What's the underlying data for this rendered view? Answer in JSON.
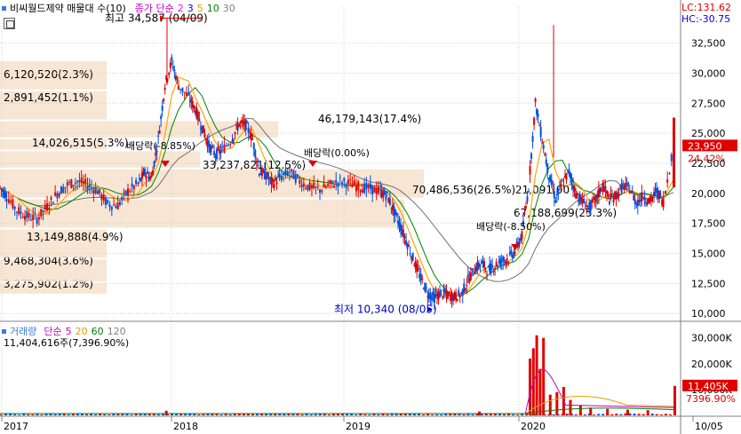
{
  "header": {
    "title": "비씨월드제약 매물대 수(10)",
    "price_label": "종가 단순",
    "ma_periods": [
      "2",
      "3",
      "5",
      "10",
      "30"
    ],
    "ma_colors": [
      "#ff00ff",
      "#0000ff",
      "#ffa500",
      "#008000",
      "#808080"
    ],
    "lc": "LC:131.62",
    "hc": "HC:-30.75"
  },
  "volume_header": {
    "label": "거래량",
    "ma_label": "단순",
    "ma_periods": [
      "5",
      "20",
      "60",
      "120"
    ],
    "ma_colors": [
      "#c000c0",
      "#e0a000",
      "#008000",
      "#808080"
    ],
    "info": "11,404,616주(7,396.90%)"
  },
  "annotations": {
    "high": "최고 34,587 (04/09)",
    "low": "최저 10,340 (08/05)",
    "dividend_1": "배당락(-8.85%)",
    "dividend_2": "배당락(0.00%)",
    "dividend_3": "배당락(-8.50%)"
  },
  "current": {
    "price": "23,950",
    "change": "24.42%",
    "volume": "11,405K",
    "volume_pct": "7396.90%"
  },
  "chart_data": [
    {
      "type": "candlestick",
      "title": "비씨월드제약 매물대 수(10)",
      "x_ticks": [
        "2017",
        "2018",
        "2019",
        "2020",
        "10/05"
      ],
      "y_ticks": [
        "10,000",
        "12,500",
        "15,000",
        "17,500",
        "20,000",
        "22,500",
        "25,000",
        "27,500",
        "30,000",
        "32,500"
      ],
      "ylim": [
        9500,
        35500
      ],
      "high": {
        "value": 34587,
        "date": "04/09"
      },
      "low": {
        "value": 10340,
        "date": "08/05"
      },
      "close_series": [
        {
          "t": 0.0,
          "v": 20500
        },
        {
          "t": 0.01,
          "v": 19800
        },
        {
          "t": 0.025,
          "v": 18600
        },
        {
          "t": 0.04,
          "v": 18100
        },
        {
          "t": 0.055,
          "v": 17900
        },
        {
          "t": 0.07,
          "v": 18900
        },
        {
          "t": 0.085,
          "v": 20000
        },
        {
          "t": 0.1,
          "v": 20700
        },
        {
          "t": 0.115,
          "v": 21000
        },
        {
          "t": 0.13,
          "v": 20700
        },
        {
          "t": 0.145,
          "v": 20200
        },
        {
          "t": 0.16,
          "v": 19100
        },
        {
          "t": 0.175,
          "v": 19000
        },
        {
          "t": 0.19,
          "v": 20200
        },
        {
          "t": 0.205,
          "v": 20800
        },
        {
          "t": 0.215,
          "v": 21700
        },
        {
          "t": 0.225,
          "v": 21300
        },
        {
          "t": 0.235,
          "v": 24500
        },
        {
          "t": 0.245,
          "v": 29000
        },
        {
          "t": 0.255,
          "v": 31000
        },
        {
          "t": 0.265,
          "v": 29000
        },
        {
          "t": 0.28,
          "v": 28000
        },
        {
          "t": 0.29,
          "v": 27000
        },
        {
          "t": 0.3,
          "v": 25500
        },
        {
          "t": 0.31,
          "v": 24000
        },
        {
          "t": 0.32,
          "v": 23200
        },
        {
          "t": 0.33,
          "v": 23600
        },
        {
          "t": 0.345,
          "v": 24600
        },
        {
          "t": 0.355,
          "v": 25800
        },
        {
          "t": 0.365,
          "v": 25700
        },
        {
          "t": 0.375,
          "v": 24500
        },
        {
          "t": 0.385,
          "v": 21800
        },
        {
          "t": 0.395,
          "v": 21500
        },
        {
          "t": 0.405,
          "v": 20800
        },
        {
          "t": 0.415,
          "v": 21300
        },
        {
          "t": 0.43,
          "v": 21800
        },
        {
          "t": 0.445,
          "v": 21000
        },
        {
          "t": 0.46,
          "v": 20500
        },
        {
          "t": 0.475,
          "v": 20300
        },
        {
          "t": 0.49,
          "v": 20700
        },
        {
          "t": 0.505,
          "v": 21000
        },
        {
          "t": 0.52,
          "v": 20800
        },
        {
          "t": 0.535,
          "v": 20500
        },
        {
          "t": 0.55,
          "v": 20400
        },
        {
          "t": 0.565,
          "v": 20100
        },
        {
          "t": 0.575,
          "v": 19800
        },
        {
          "t": 0.585,
          "v": 18500
        },
        {
          "t": 0.595,
          "v": 17200
        },
        {
          "t": 0.605,
          "v": 15800
        },
        {
          "t": 0.615,
          "v": 14300
        },
        {
          "t": 0.625,
          "v": 12900
        },
        {
          "t": 0.635,
          "v": 11700
        },
        {
          "t": 0.645,
          "v": 11300
        },
        {
          "t": 0.655,
          "v": 11700
        },
        {
          "t": 0.665,
          "v": 11500
        },
        {
          "t": 0.675,
          "v": 11400
        },
        {
          "t": 0.685,
          "v": 11600
        },
        {
          "t": 0.695,
          "v": 12800
        },
        {
          "t": 0.705,
          "v": 13700
        },
        {
          "t": 0.715,
          "v": 14200
        },
        {
          "t": 0.725,
          "v": 13600
        },
        {
          "t": 0.735,
          "v": 14000
        },
        {
          "t": 0.745,
          "v": 14400
        },
        {
          "t": 0.755,
          "v": 14600
        },
        {
          "t": 0.765,
          "v": 15200
        },
        {
          "t": 0.775,
          "v": 16500
        },
        {
          "t": 0.785,
          "v": 20500
        },
        {
          "t": 0.795,
          "v": 27500
        },
        {
          "t": 0.805,
          "v": 24500
        },
        {
          "t": 0.815,
          "v": 21500
        },
        {
          "t": 0.825,
          "v": 19500
        },
        {
          "t": 0.835,
          "v": 20800
        },
        {
          "t": 0.845,
          "v": 21800
        },
        {
          "t": 0.855,
          "v": 20000
        },
        {
          "t": 0.865,
          "v": 19300
        },
        {
          "t": 0.875,
          "v": 18800
        },
        {
          "t": 0.885,
          "v": 19500
        },
        {
          "t": 0.895,
          "v": 20700
        },
        {
          "t": 0.905,
          "v": 19500
        },
        {
          "t": 0.915,
          "v": 19800
        },
        {
          "t": 0.925,
          "v": 20600
        },
        {
          "t": 0.935,
          "v": 20400
        },
        {
          "t": 0.945,
          "v": 19200
        },
        {
          "t": 0.955,
          "v": 19800
        },
        {
          "t": 0.965,
          "v": 19300
        },
        {
          "t": 0.975,
          "v": 20200
        },
        {
          "t": 0.985,
          "v": 19300
        },
        {
          "t": 1.0,
          "v": 23950
        }
      ],
      "volume_profile": [
        {
          "label": "3,275,902(1.2%)",
          "from": 11500,
          "to": 12500,
          "share": 0.012
        },
        {
          "label": "9,468,304(3.6%)",
          "from": 12500,
          "to": 14500,
          "share": 0.036
        },
        {
          "label": "13,149,888(4.9%)",
          "from": 14500,
          "to": 17000,
          "share": 0.049
        },
        {
          "label": "67,188,699(25.3%)",
          "from": 17000,
          "to": 19500,
          "share": 0.253
        },
        {
          "label": "70,486,536(26.5%)",
          "from": 19500,
          "to": 22000,
          "share": 0.265
        },
        {
          "label": "33,237,821(12.5%)",
          "from": 22000,
          "to": 23500,
          "share": 0.125
        },
        {
          "label": "14,026,515(5.3%)",
          "from": 23500,
          "to": 24500,
          "share": 0.053
        },
        {
          "label": "46,179,143(17.4%)",
          "from": 24500,
          "to": 26000,
          "share": 0.174
        },
        {
          "label": "2,891,452(1.1%)",
          "from": 26000,
          "to": 28500,
          "share": 0.011
        },
        {
          "label": "6,120,520(2.3%)",
          "from": 28500,
          "to": 31000,
          "share": 0.023
        },
        {
          "label": "21,091,00",
          "from": 19500,
          "to": 22000,
          "share": 0.0
        }
      ],
      "dividend_markers": [
        {
          "t": 0.16,
          "label": "배당락(-8.85%)"
        },
        {
          "t": 0.365,
          "label": "배당락(0.00%)"
        },
        {
          "t": 0.74,
          "label": "배당락(-8.50%)"
        }
      ]
    },
    {
      "type": "bar",
      "title": "거래량",
      "y_ticks": [
        "10,000K",
        "20,000K",
        "30,000K"
      ],
      "ylim": [
        0,
        33000
      ],
      "spikes": [
        {
          "t": 0.245,
          "v": 1800
        },
        {
          "t": 0.71,
          "v": 1500
        },
        {
          "t": 0.785,
          "v": 22000
        },
        {
          "t": 0.79,
          "v": 26000
        },
        {
          "t": 0.795,
          "v": 31000
        },
        {
          "t": 0.8,
          "v": 18000
        },
        {
          "t": 0.805,
          "v": 30000
        },
        {
          "t": 0.815,
          "v": 8000
        },
        {
          "t": 0.825,
          "v": 9000
        },
        {
          "t": 0.835,
          "v": 11000
        },
        {
          "t": 0.845,
          "v": 6000
        },
        {
          "t": 0.86,
          "v": 4000
        },
        {
          "t": 0.875,
          "v": 3000
        },
        {
          "t": 0.9,
          "v": 2500
        },
        {
          "t": 0.93,
          "v": 2200
        },
        {
          "t": 0.96,
          "v": 2000
        },
        {
          "t": 1.0,
          "v": 11405
        }
      ]
    }
  ]
}
